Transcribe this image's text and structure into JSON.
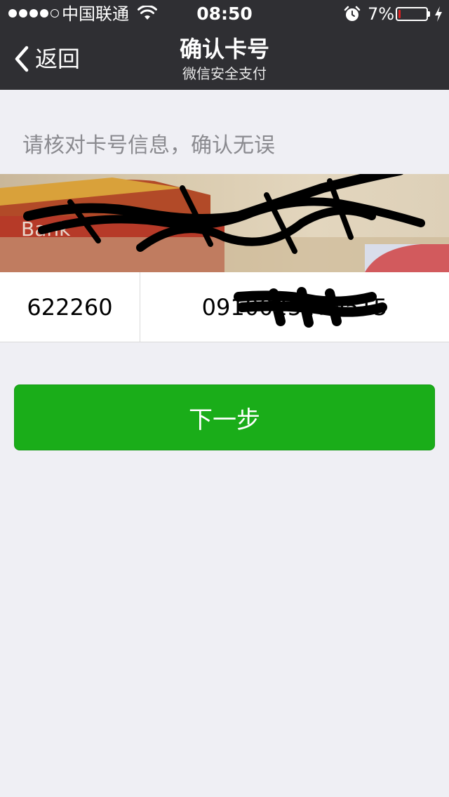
{
  "status_bar": {
    "carrier": "中国联通",
    "time": "08:50",
    "battery_percent": "7%",
    "battery_level": 0.07
  },
  "nav": {
    "back_label": "返回",
    "title": "确认卡号",
    "subtitle": "微信安全支付"
  },
  "prompt": "请核对卡号信息，确认无误",
  "card_number": {
    "prefix": "622260",
    "rest": "0910025470515"
  },
  "next_button": "下一步",
  "colors": {
    "nav_bg": "#2f2f33",
    "page_bg": "#efeff4",
    "accent_green": "#1aad19",
    "battery_low": "#e02020"
  },
  "icons": [
    "signal-dots",
    "wifi-icon",
    "alarm-icon",
    "battery-icon",
    "charging-icon",
    "chevron-left-icon"
  ]
}
